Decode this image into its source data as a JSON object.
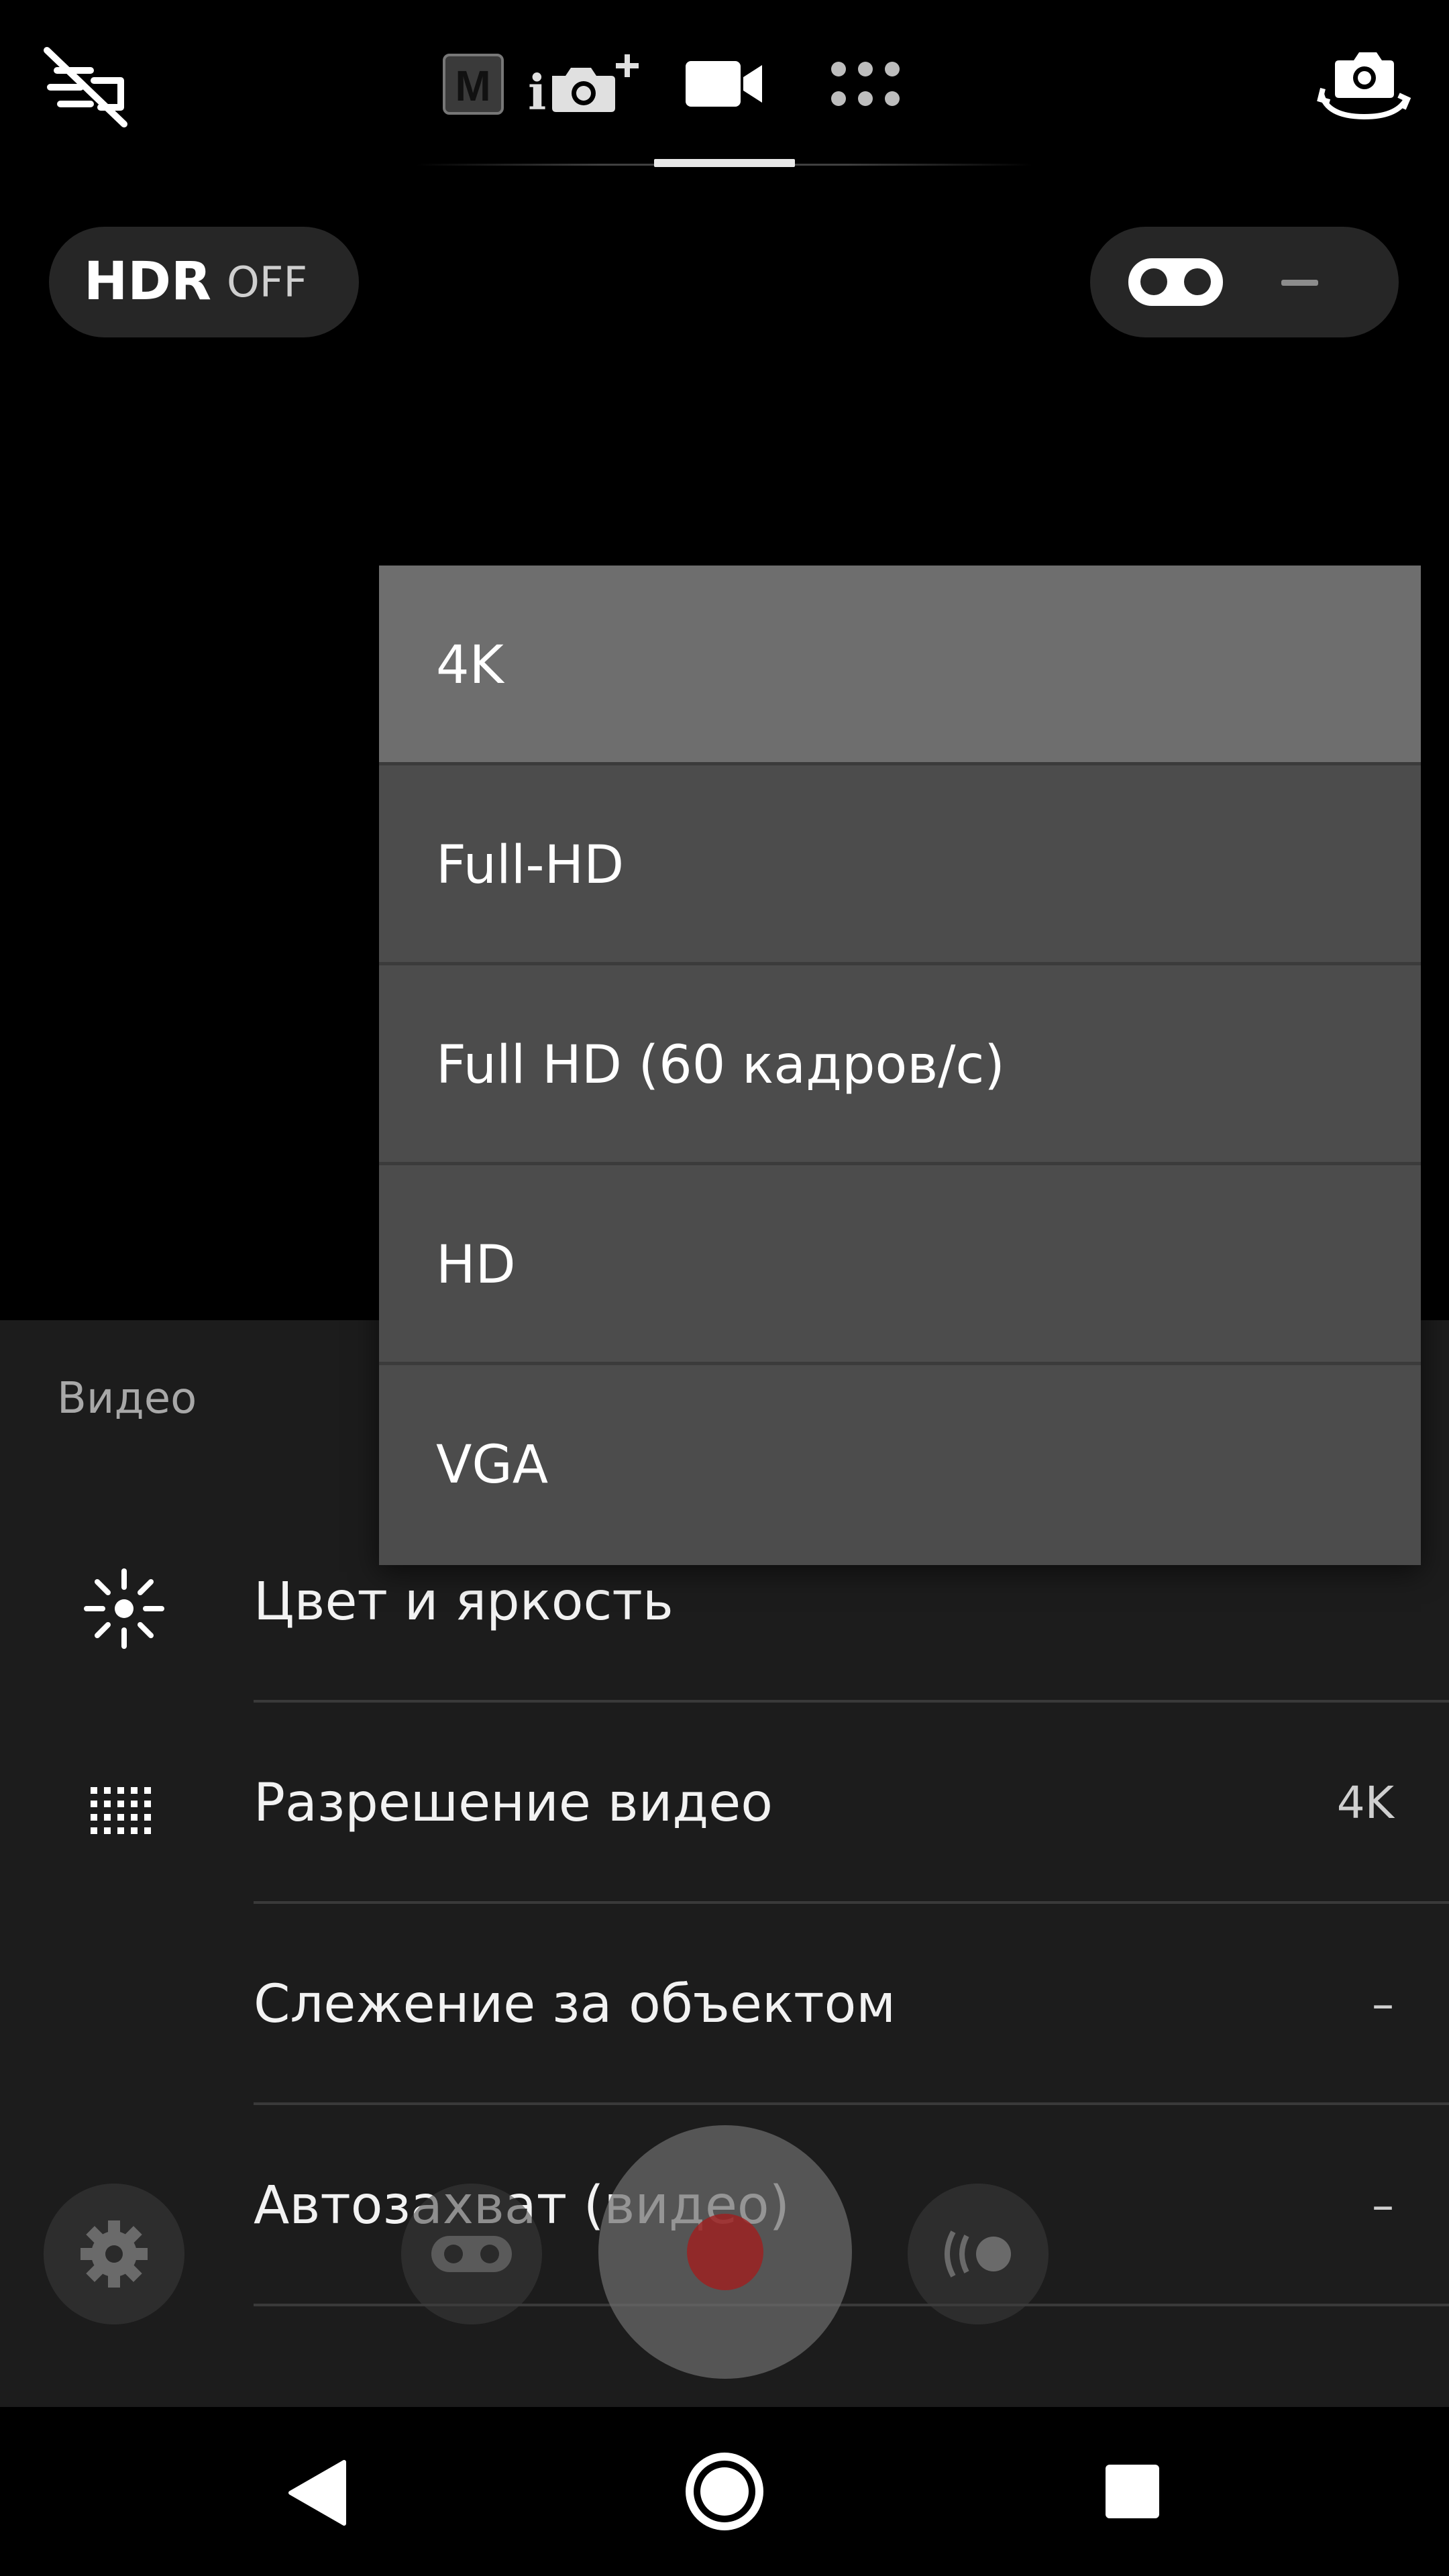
{
  "top_bar": {
    "flash_icon": "flash-off-icon",
    "modes": [
      {
        "name": "manual",
        "icon": "manual-mode-icon",
        "label": "M"
      },
      {
        "name": "superior-auto",
        "icon": "superior-auto-icon",
        "label": "i"
      },
      {
        "name": "video",
        "icon": "video-camera-icon",
        "active": true
      },
      {
        "name": "more",
        "icon": "more-modes-icon"
      }
    ],
    "switch_camera_icon": "switch-camera-icon"
  },
  "hdr": {
    "label": "HDR",
    "value": "OFF"
  },
  "dual_pill": {
    "icon": "dual-lens-icon",
    "value": "–"
  },
  "dropdown": {
    "items": [
      {
        "label": "4K",
        "selected": true
      },
      {
        "label": "Full-HD",
        "selected": false
      },
      {
        "label": "Full HD (60 кадров/с)",
        "selected": false
      },
      {
        "label": "HD",
        "selected": false
      },
      {
        "label": "VGA",
        "selected": false
      }
    ]
  },
  "panel": {
    "title": "Видео",
    "settings": [
      {
        "label": "Цвет и яркость",
        "value": "",
        "icon": "brightness-icon"
      },
      {
        "label": "Разрешение видео",
        "value": "4K",
        "icon": "grid-resolution-icon"
      },
      {
        "label": "Слежение за объектом",
        "value": "–",
        "icon": ""
      },
      {
        "label": "Автозахват (видео)",
        "value": "–",
        "icon": ""
      }
    ]
  },
  "shutter_bar": {
    "settings_icon": "gear-icon",
    "dual_icon": "dual-lens-icon",
    "record_icon": "record-icon",
    "stabilizer_icon": "steadyshot-icon"
  },
  "nav": {
    "back_icon": "back-icon",
    "home_icon": "home-icon",
    "recents_icon": "recents-icon"
  },
  "colors": {
    "panel_bg": "#1c1c1c",
    "dropdown_bg": "#4c4c4c",
    "dropdown_selected_bg": "#6e6e6e",
    "record_red": "#a01e1e"
  }
}
